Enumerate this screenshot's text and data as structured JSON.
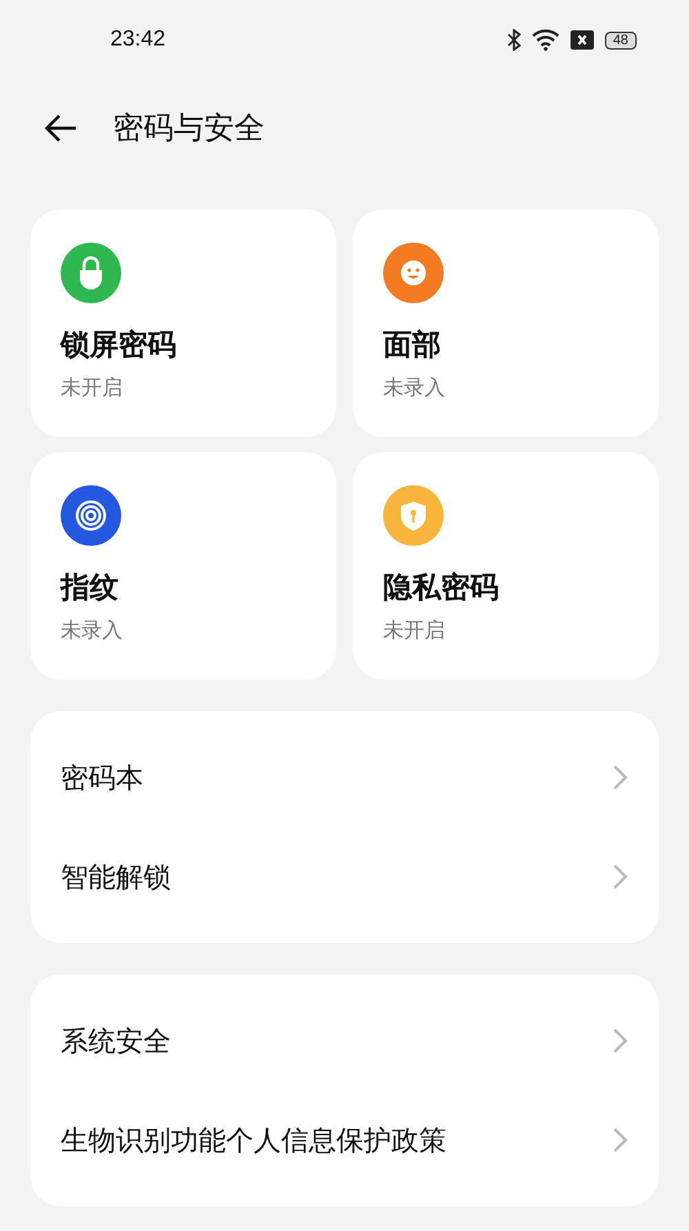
{
  "status_bar": {
    "time": "23:42",
    "battery": "48"
  },
  "header": {
    "title": "密码与安全"
  },
  "tiles": [
    {
      "kind": "lock",
      "title": "锁屏密码",
      "status": "未开启",
      "color": "#2fb84f"
    },
    {
      "kind": "face",
      "title": "面部",
      "status": "未录入",
      "color": "#f47b22"
    },
    {
      "kind": "fingerprint",
      "title": "指纹",
      "status": "未录入",
      "color": "#2458e0"
    },
    {
      "kind": "shield",
      "title": "隐私密码",
      "status": "未开启",
      "color": "#f9b43c"
    }
  ],
  "groups": [
    {
      "items": [
        {
          "label": "密码本"
        },
        {
          "label": "智能解锁"
        }
      ]
    },
    {
      "items": [
        {
          "label": "系统安全"
        },
        {
          "label": "生物识别功能个人信息保护政策"
        }
      ]
    }
  ]
}
